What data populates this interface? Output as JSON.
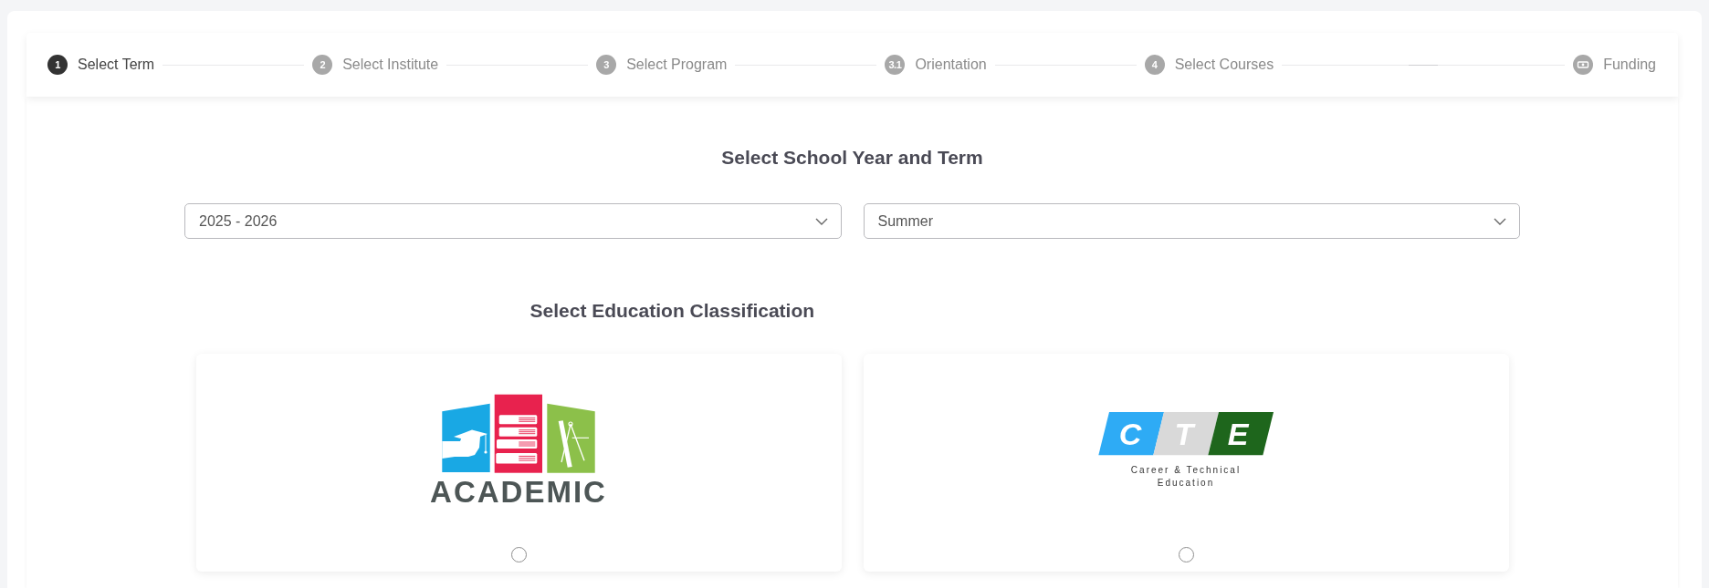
{
  "stepper": {
    "steps": [
      {
        "kind": "number",
        "number": "1",
        "label": "Select Term",
        "selected": true
      },
      {
        "kind": "number",
        "number": "2",
        "label": "Select Institute",
        "selected": false
      },
      {
        "kind": "number",
        "number": "3",
        "label": "Select Program",
        "selected": false
      },
      {
        "kind": "number",
        "number": "3.1",
        "label": "Orientation",
        "selected": false
      },
      {
        "kind": "number",
        "number": "4",
        "label": "Select Courses",
        "selected": false
      },
      {
        "kind": "icon",
        "label": "Funding",
        "selected": false
      }
    ]
  },
  "term_section": {
    "title": "Select School Year and Term",
    "fields": [
      {
        "value": "2025 - 2026"
      },
      {
        "value": "Summer"
      }
    ]
  },
  "classification_section": {
    "title": "Select Education Classification",
    "options": [
      {
        "kind": "academic",
        "wordmark": "ACADEMIC",
        "selected": false
      },
      {
        "kind": "cte",
        "letters": [
          "C",
          "T",
          "E"
        ],
        "caption": "Career & Technical Education",
        "selected": false
      }
    ]
  }
}
